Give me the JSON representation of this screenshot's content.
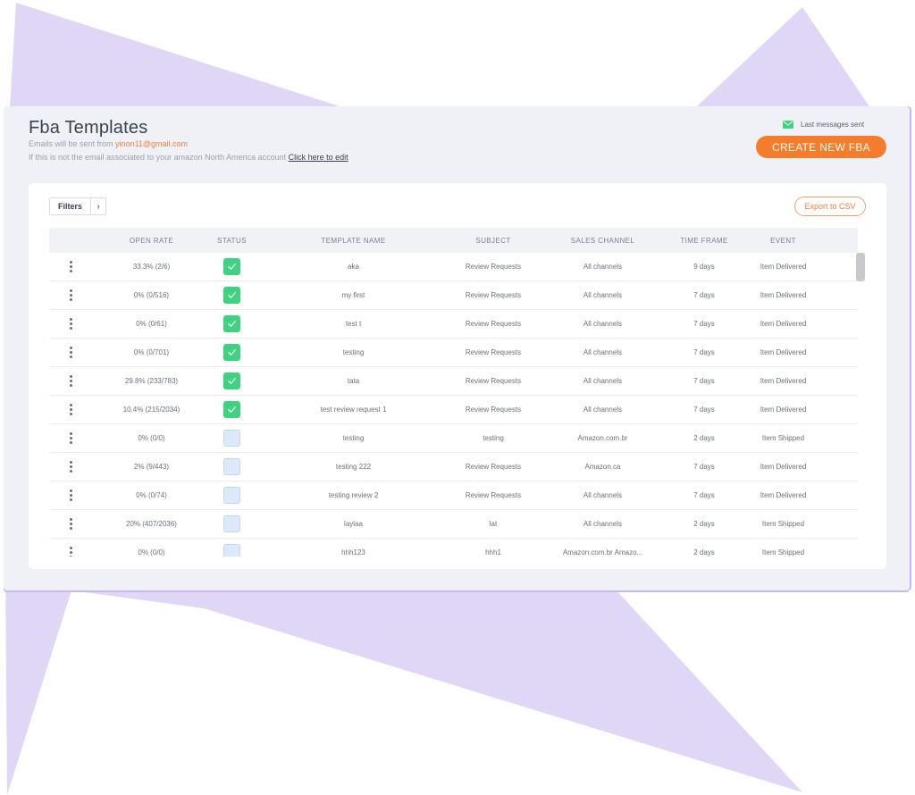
{
  "header": {
    "title": "Fba Templates",
    "sender_prefix": "Emails will be sent from",
    "sender_email": "yinon11@gmail.com",
    "notice_text": "If this is not the email associated to your amazon North America account",
    "edit_link": "Click here to edit",
    "last_messages": "Last messages sent",
    "create_button": "CREATE NEW FBA"
  },
  "toolbar": {
    "filters_label": "Filters",
    "filters_arrow": "›",
    "export_label": "Export to CSV"
  },
  "table": {
    "columns": [
      "OPEN RATE",
      "STATUS",
      "TEMPLATE NAME",
      "SUBJECT",
      "SALES CHANNEL",
      "TIME FRAME",
      "EVENT"
    ],
    "rows": [
      {
        "open_rate": "33.3% (2/6)",
        "active": true,
        "name": "aka",
        "subject": "Review Requests",
        "channel": "All channels",
        "time_frame": "9 days",
        "event": "Item Delivered"
      },
      {
        "open_rate": "0% (0/516)",
        "active": true,
        "name": "my first",
        "subject": "Review Requests",
        "channel": "All channels",
        "time_frame": "7 days",
        "event": "Item Delivered"
      },
      {
        "open_rate": "0% (0/61)",
        "active": true,
        "name": "test t",
        "subject": "Review Requests",
        "channel": "All channels",
        "time_frame": "7 days",
        "event": "Item Delivered"
      },
      {
        "open_rate": "0% (0/701)",
        "active": true,
        "name": "testing",
        "subject": "Review Requests",
        "channel": "All channels",
        "time_frame": "7 days",
        "event": "Item Delivered"
      },
      {
        "open_rate": "29.8% (233/783)",
        "active": true,
        "name": "tata",
        "subject": "Review Requests",
        "channel": "All channels",
        "time_frame": "7 days",
        "event": "Item Delivered"
      },
      {
        "open_rate": "10.4% (215/2034)",
        "active": true,
        "name": "test review request 1",
        "subject": "Review Requests",
        "channel": "All channels",
        "time_frame": "7 days",
        "event": "Item Delivered"
      },
      {
        "open_rate": "0% (0/0)",
        "active": false,
        "name": "testing",
        "subject": "testing",
        "channel": "Amazon.com.br",
        "time_frame": "2 days",
        "event": "Item Shipped"
      },
      {
        "open_rate": "2% (9/443)",
        "active": false,
        "name": "testing 222",
        "subject": "Review Requests",
        "channel": "Amazon.ca",
        "time_frame": "7 days",
        "event": "Item Delivered"
      },
      {
        "open_rate": "0% (0/74)",
        "active": false,
        "name": "testing review 2",
        "subject": "Review Requests",
        "channel": "All channels",
        "time_frame": "7 days",
        "event": "Item Delivered"
      },
      {
        "open_rate": "20% (407/2036)",
        "active": false,
        "name": "laylaa",
        "subject": "lat",
        "channel": "All channels",
        "time_frame": "2 days",
        "event": "Item Shipped"
      },
      {
        "open_rate": "0% (0/0)",
        "active": false,
        "name": "hhh123",
        "subject": "hhh1",
        "channel": "Amazon.com.br Amazo...",
        "time_frame": "2 days",
        "event": "Item Shipped"
      }
    ]
  },
  "colors": {
    "accent_orange": "#f57c2a",
    "status_active": "#3fd282",
    "status_inactive": "#dce9fb",
    "background_shape": "#e0d6f5"
  },
  "icons": {
    "envelope": "envelope-icon",
    "check": "check-icon",
    "row_menu": "kebab-menu-icon"
  }
}
